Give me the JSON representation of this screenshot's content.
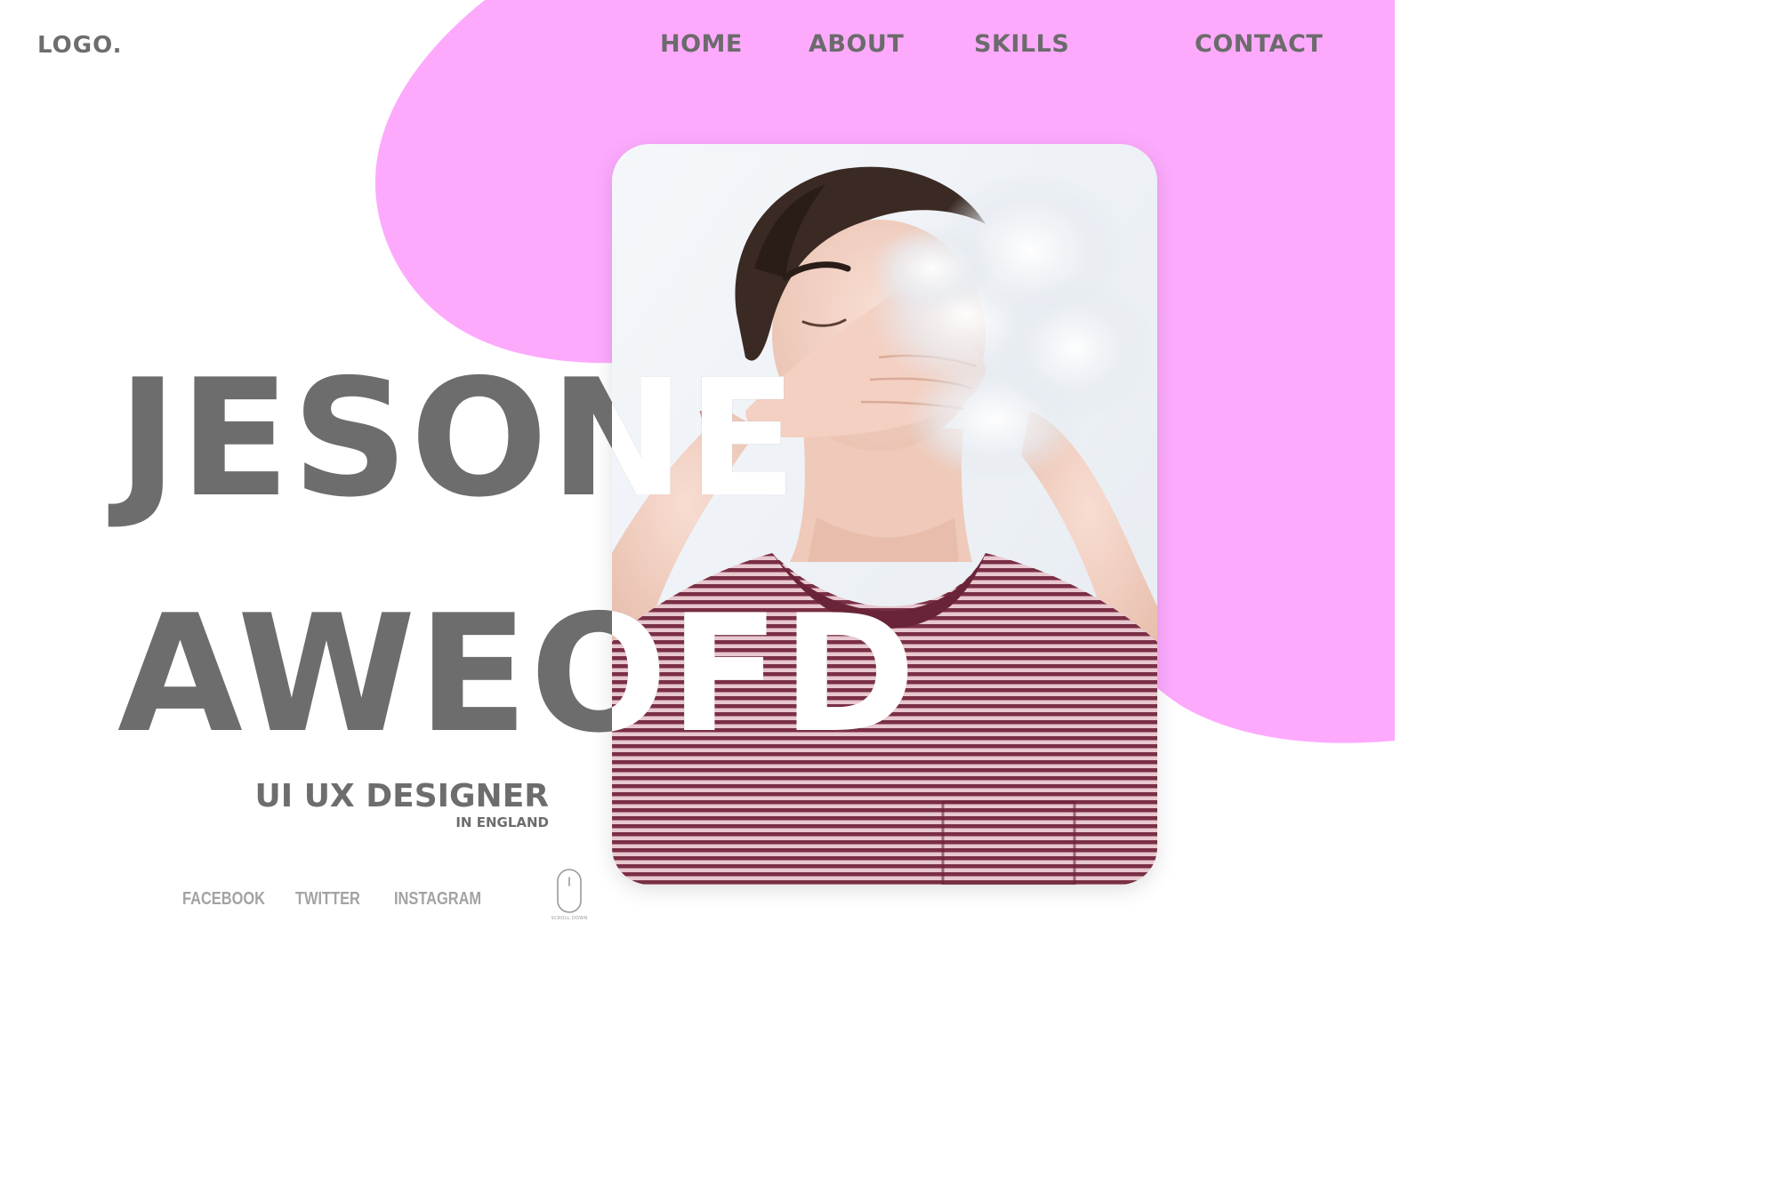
{
  "header": {
    "logo": "LOGO.",
    "nav": {
      "home": "HOME",
      "about": "ABOUT",
      "skills": "SKILLS",
      "contact": "CONTACT"
    }
  },
  "hero": {
    "name_line1": "JESONE",
    "name_line2": "AWEOFD",
    "role_title": "UI UX DESIGNER",
    "role_location": "IN ENGLAND"
  },
  "social": {
    "facebook": "FACEBOOK",
    "twitter": "TWITTER",
    "instagram": "INSTAGRAM"
  },
  "scroll": {
    "label": "SCROLL DOWN"
  },
  "colors": {
    "accent_pink": "#fdaafd",
    "text_gray": "#6d6d6d",
    "social_gray": "#a3a3a3",
    "background": "#ffffff"
  },
  "icons": {
    "scroll": "mouse-icon",
    "photo": "portrait-photo"
  }
}
